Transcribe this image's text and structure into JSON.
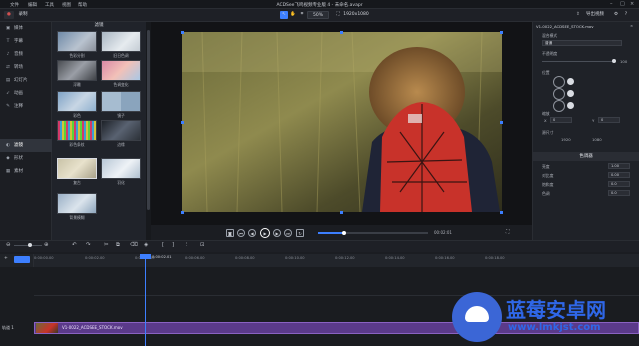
{
  "app": {
    "window_title": "ACDSee飞鸣视频专业版 4 - 未命名.avapr",
    "menu": [
      "文件",
      "编辑",
      "工具",
      "视图",
      "帮助"
    ]
  },
  "toolbar": {
    "zoom": "50%",
    "resolution": "1920x1080",
    "export_label": "导出视频"
  },
  "left_nav": {
    "items": [
      {
        "icon": "media-icon",
        "label": "媒体"
      },
      {
        "icon": "text-icon",
        "label": "字幕"
      },
      {
        "icon": "audio-icon",
        "label": "音频"
      },
      {
        "icon": "transition-icon",
        "label": "转场"
      },
      {
        "icon": "slide-icon",
        "label": "幻灯片"
      },
      {
        "icon": "animation-icon",
        "label": "动画"
      },
      {
        "icon": "annotation-icon",
        "label": "注释"
      },
      {
        "icon": "filter-icon",
        "label": "滤镜",
        "active": true
      },
      {
        "icon": "shape-icon",
        "label": "形状"
      },
      {
        "icon": "elements-icon",
        "label": "素材"
      }
    ]
  },
  "media_panel": {
    "header": "滤镜",
    "items": [
      {
        "label": "色彩分割"
      },
      {
        "label": "旧日色调"
      },
      {
        "label": "浮雕"
      },
      {
        "label": "色调变化"
      },
      {
        "label": "彩色"
      },
      {
        "label": "镜子"
      },
      {
        "label": "彩色条纹"
      },
      {
        "label": "边缘"
      },
      {
        "label": "复古"
      },
      {
        "label": "羽化"
      },
      {
        "label": "背景模糊"
      }
    ]
  },
  "preview": {
    "time": "00:02:01"
  },
  "right_panel": {
    "clip_name": "V1-0022_ACDSEE_STOCK.mov",
    "section1": "混合模式",
    "blend_mode": "普通",
    "opacity_label": "不透明度",
    "opacity_value": "100",
    "position_label": "位置",
    "scale_label": "缩放",
    "x_label": "X",
    "y_label": "Y",
    "x_value": "0",
    "y_value": "0",
    "size_label": "源尺寸",
    "size_w": "1920",
    "size_h": "1080",
    "section2": "色调器",
    "fields": [
      {
        "label": "亮度",
        "value": "1.00"
      },
      {
        "label": "对比度",
        "value": "0.00"
      },
      {
        "label": "饱和度",
        "value": "0.0"
      },
      {
        "label": "色调",
        "value": "0.0"
      }
    ]
  },
  "timeline": {
    "ruler_ticks": [
      "0:00:00.00",
      "0:00:02.00",
      "0:00:04.00",
      "0:00:06.00",
      "0:00:08.00",
      "0:00:10.00",
      "0:00:12.00",
      "0:00:14.00",
      "0:00:16.00",
      "0:00:18.00"
    ],
    "playhead_time": "0:00:02.01",
    "track_label": "轨道 1",
    "clip_label": "V1-0022_ACDSEE_STOCK.mov"
  },
  "watermark": {
    "text": "蓝莓安卓网",
    "url": "www.lmkjst.com"
  },
  "colors": {
    "accent": "#3d7fff",
    "clip": "#5b3a8a",
    "backpack": "#c8322a"
  }
}
